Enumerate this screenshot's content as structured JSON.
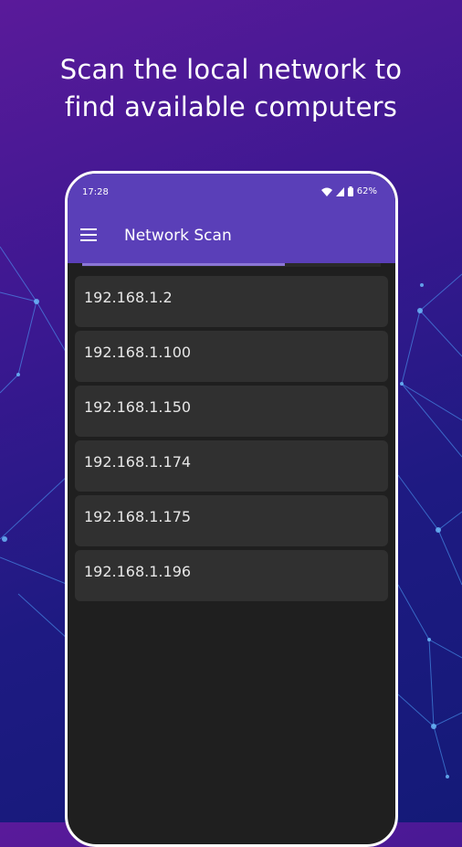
{
  "headline": {
    "line1": "Scan the local network to",
    "line2": "find available computers"
  },
  "status_bar": {
    "time": "17:28",
    "battery": "62%",
    "icons": [
      "wifi-icon",
      "signal-icon",
      "battery-icon"
    ]
  },
  "app_bar": {
    "title": "Network Scan",
    "menu_icon": "hamburger-menu-icon"
  },
  "scan_progress": 0.68,
  "hosts": [
    "192.168.1.2",
    "192.168.1.100",
    "192.168.1.150",
    "192.168.1.174",
    "192.168.1.175",
    "192.168.1.196"
  ],
  "colors": {
    "accent": "#5a3fb8",
    "progress": "#8b76d6",
    "item_bg": "#303030",
    "screen_bg": "#1f1f1f"
  }
}
